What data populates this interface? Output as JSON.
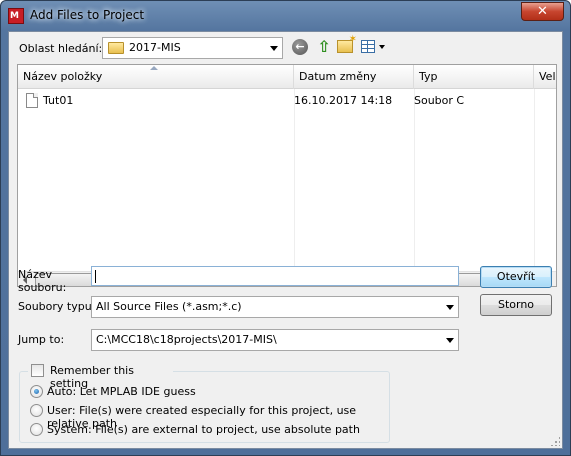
{
  "window": {
    "title": "Add Files to Project",
    "close_glyph": "✕",
    "app_icon_text": "M"
  },
  "lookin": {
    "label": "Oblast hledání:",
    "value": "2017-MIS"
  },
  "toolbar": {
    "back_glyph": "←",
    "up_glyph": "⇧"
  },
  "listview": {
    "columns": [
      "Název položky",
      "Datum změny",
      "Typ",
      "Velik"
    ],
    "rows": [
      {
        "name": "Tut01",
        "date": "16.10.2017 14:18",
        "type": "Soubor C"
      }
    ],
    "scroll_grip": "III"
  },
  "filename": {
    "label": "Název\nsouboru:",
    "label_line1": "Název",
    "label_line2": "souboru:",
    "value": ""
  },
  "filetype": {
    "label": "Soubory typu:",
    "value": "All Source Files (*.asm;*.c)"
  },
  "jumpto": {
    "label": "Jump to:",
    "value": "C:\\MCC18\\c18projects\\2017-MIS\\"
  },
  "buttons": {
    "open": "Otevřít",
    "cancel": "Storno"
  },
  "remember": {
    "label": "Remember this setting",
    "checked": false
  },
  "options": {
    "selected": 0,
    "items": [
      "Auto: Let MPLAB IDE guess",
      "User: File(s) were created especially for this project, use relative path",
      "System: File(s) are external to project, use absolute path"
    ]
  }
}
